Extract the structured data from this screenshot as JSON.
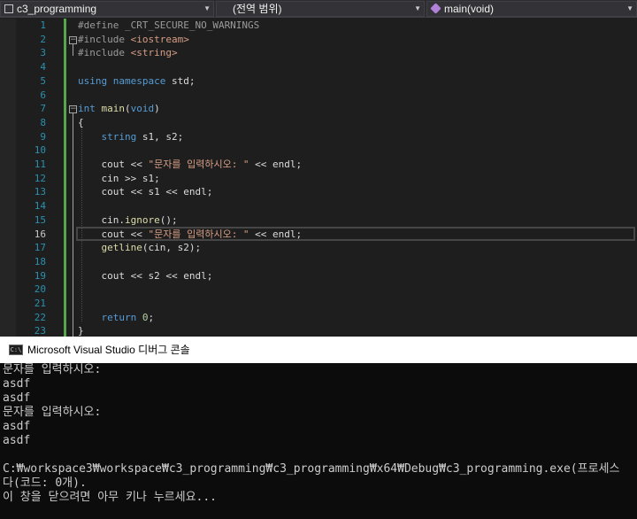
{
  "nav": {
    "project": "c3_programming",
    "scope": "(전역 범위)",
    "member": "main(void)"
  },
  "editor": {
    "current_line": 16,
    "lines": [
      {
        "n": "1",
        "tokens": [
          [
            "pp",
            "#define _CRT_SECURE_NO_WARNINGS"
          ]
        ]
      },
      {
        "n": "2",
        "tokens": [
          [
            "pp",
            "#include "
          ],
          [
            "inc",
            "<iostream>"
          ]
        ]
      },
      {
        "n": "3",
        "tokens": [
          [
            "pp",
            "#include "
          ],
          [
            "inc",
            "<string>"
          ]
        ]
      },
      {
        "n": "4",
        "tokens": []
      },
      {
        "n": "5",
        "tokens": [
          [
            "kw",
            "using"
          ],
          [
            "",
            " "
          ],
          [
            "kw",
            "namespace"
          ],
          [
            "",
            " std;"
          ]
        ]
      },
      {
        "n": "6",
        "tokens": []
      },
      {
        "n": "7",
        "tokens": [
          [
            "kw",
            "int"
          ],
          [
            "",
            " "
          ],
          [
            "fn",
            "main"
          ],
          [
            "",
            "("
          ],
          [
            "kw",
            "void"
          ],
          [
            "",
            ")"
          ]
        ]
      },
      {
        "n": "8",
        "tokens": [
          [
            "",
            "{"
          ]
        ]
      },
      {
        "n": "9",
        "tokens": [
          [
            "",
            "    "
          ],
          [
            "kw",
            "string"
          ],
          [
            "",
            " s1, s2;"
          ]
        ]
      },
      {
        "n": "10",
        "tokens": []
      },
      {
        "n": "11",
        "tokens": [
          [
            "",
            "    cout << "
          ],
          [
            "str",
            "\"문자를 입력하시오: \""
          ],
          [
            "",
            " << endl;"
          ]
        ]
      },
      {
        "n": "12",
        "tokens": [
          [
            "",
            "    cin >> s1;"
          ]
        ]
      },
      {
        "n": "13",
        "tokens": [
          [
            "",
            "    cout << s1 << endl;"
          ]
        ]
      },
      {
        "n": "14",
        "tokens": []
      },
      {
        "n": "15",
        "tokens": [
          [
            "",
            "    cin."
          ],
          [
            "fn",
            "ignore"
          ],
          [
            "",
            "();"
          ]
        ]
      },
      {
        "n": "16",
        "tokens": [
          [
            "",
            "    cout << "
          ],
          [
            "str",
            "\"문자를 입력하시오: \""
          ],
          [
            "",
            " << endl;"
          ]
        ]
      },
      {
        "n": "17",
        "tokens": [
          [
            "",
            "    "
          ],
          [
            "fn",
            "getline"
          ],
          [
            "",
            "(cin, s2);"
          ]
        ]
      },
      {
        "n": "18",
        "tokens": []
      },
      {
        "n": "19",
        "tokens": [
          [
            "",
            "    cout << s2 << endl;"
          ]
        ]
      },
      {
        "n": "20",
        "tokens": []
      },
      {
        "n": "21",
        "tokens": []
      },
      {
        "n": "22",
        "tokens": [
          [
            "",
            "    "
          ],
          [
            "kw",
            "return"
          ],
          [
            "",
            " "
          ],
          [
            "num",
            "0"
          ],
          [
            "",
            ";"
          ]
        ]
      },
      {
        "n": "23",
        "tokens": [
          [
            "",
            "}"
          ]
        ]
      }
    ]
  },
  "console": {
    "title": "Microsoft Visual Studio 디버그 콘솔",
    "icon_label": "C:\\",
    "lines": [
      "문자를 입력하시오:",
      "asdf",
      "asdf",
      "문자를 입력하시오:",
      "asdf",
      "asdf",
      "",
      "C:₩workspace3₩workspace₩c3_programming₩c3_programming₩x64₩Debug₩c3_programming.exe(프로세스",
      "다(코드: 0개).",
      "이 창을 닫으려면 아무 키나 누르세요..."
    ]
  },
  "colors": {
    "keyword": "#569cd6",
    "string": "#d69d85",
    "preprocessor": "#9b9b9b",
    "line_number": "#2b91af",
    "console_bg": "#0c0c0c",
    "editor_bg": "#1e1e1e"
  }
}
